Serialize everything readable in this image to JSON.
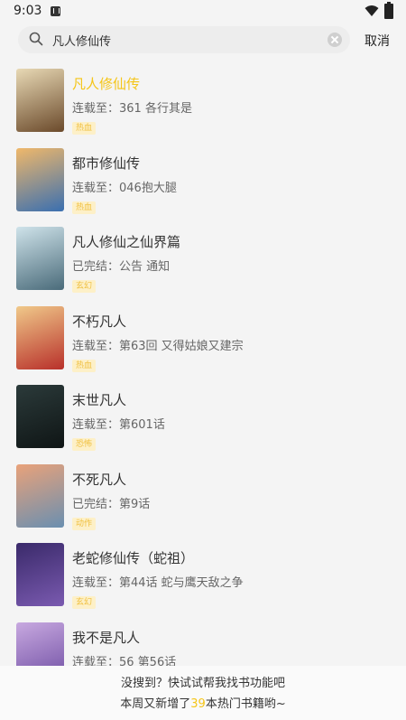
{
  "status_bar": {
    "time": "9:03"
  },
  "search": {
    "query": "凡人修仙传",
    "cancel_label": "取消"
  },
  "results": [
    {
      "title": "凡人修仙传",
      "status": "连载至：361 各行其是",
      "tag": "热血",
      "highlight": true,
      "cover_colors": [
        "#e8d9b5",
        "#6b4a2b"
      ]
    },
    {
      "title": "都市修仙传",
      "status": "连载至：046抱大腿",
      "tag": "热血",
      "highlight": false,
      "cover_colors": [
        "#f0b86a",
        "#3a6fb0"
      ]
    },
    {
      "title": "凡人修仙之仙界篇",
      "status": "已完结：公告 通知",
      "tag": "玄幻",
      "highlight": false,
      "cover_colors": [
        "#cfe3ea",
        "#4a6b7a"
      ]
    },
    {
      "title": "不朽凡人",
      "status": "连载至：第63回 又得姑娘又建宗",
      "tag": "热血",
      "highlight": false,
      "cover_colors": [
        "#f0c98a",
        "#b8302a"
      ]
    },
    {
      "title": "末世凡人",
      "status": "连载至：第601话",
      "tag": "恐怖",
      "highlight": false,
      "cover_colors": [
        "#2b3a3a",
        "#0f1515"
      ]
    },
    {
      "title": "不死凡人",
      "status": "已完结：第9话",
      "tag": "动作",
      "highlight": false,
      "cover_colors": [
        "#e9a27a",
        "#6a8fb0"
      ]
    },
    {
      "title": "老蛇修仙传（蛇祖）",
      "status": "连载至：第44话 蛇与鹰天敌之争",
      "tag": "玄幻",
      "highlight": false,
      "cover_colors": [
        "#3a2a6a",
        "#7a5ab0"
      ]
    },
    {
      "title": "我不是凡人",
      "status": "连载至：56 第56话",
      "tag": "",
      "highlight": false,
      "cover_colors": [
        "#c8a9e0",
        "#6b4aa0"
      ]
    }
  ],
  "banner": {
    "line1": "没搜到？快试试帮我找书功能吧",
    "line2_prefix": "本周又新增了",
    "count": "39",
    "line2_suffix": "本热门书籍哟~"
  },
  "colors": {
    "accent": "#f5c518",
    "tag_bg": "#fdf0c8"
  }
}
